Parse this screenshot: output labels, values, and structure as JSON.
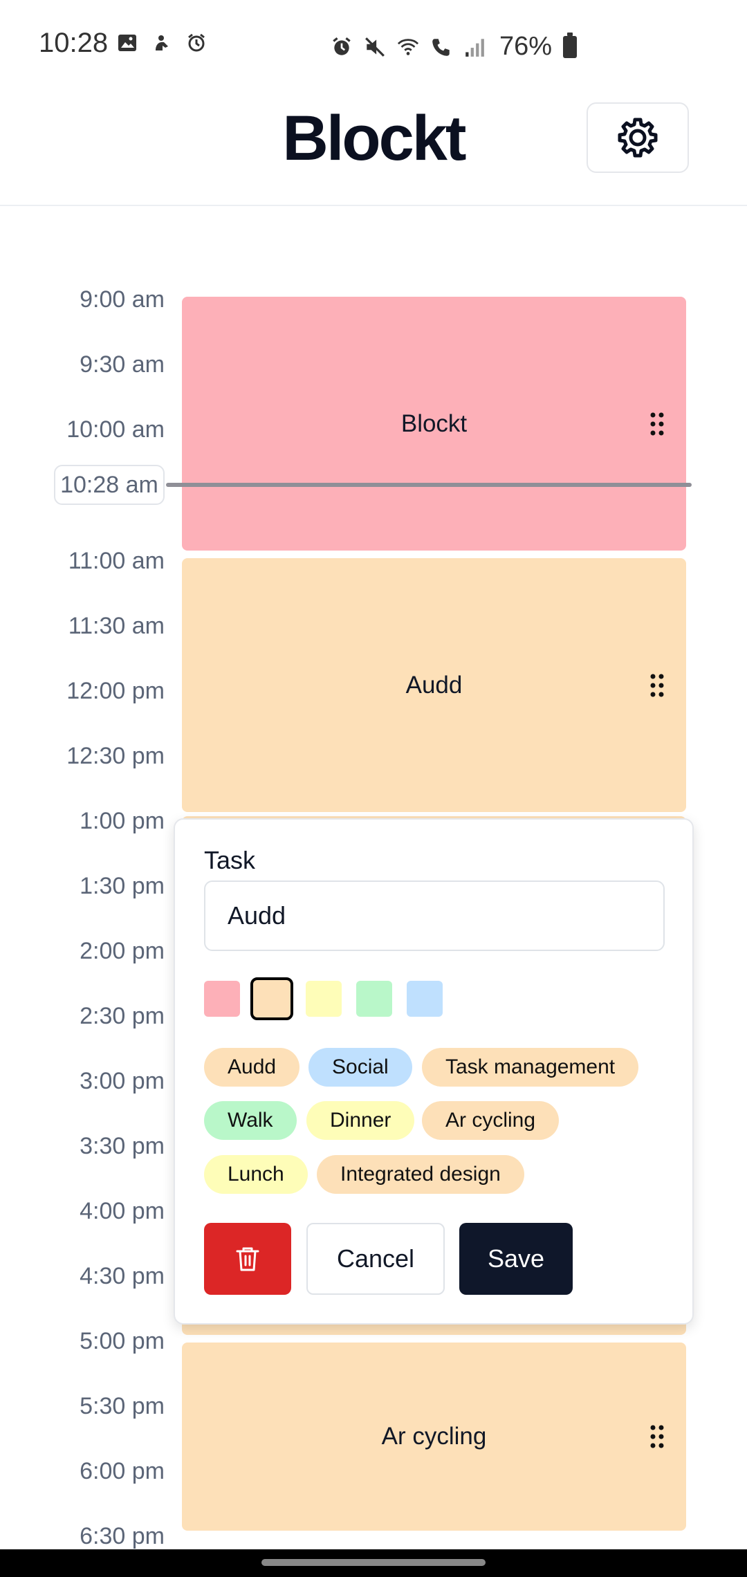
{
  "status_bar": {
    "time": "10:28",
    "battery_percent": "76%"
  },
  "header": {
    "title": "Blockt"
  },
  "timeline": {
    "labels": [
      "9:00 am",
      "9:30 am",
      "10:00 am",
      "11:00 am",
      "11:30 am",
      "12:00 pm",
      "12:30 pm",
      "1:00 pm",
      "1:30 pm",
      "2:00 pm",
      "2:30 pm",
      "3:00 pm",
      "3:30 pm",
      "4:00 pm",
      "4:30 pm",
      "5:00 pm",
      "5:30 pm",
      "6:00 pm",
      "6:30 pm"
    ],
    "now_label": "10:28 am"
  },
  "blocks": [
    {
      "title": "Blockt",
      "color": "#fdb0b8"
    },
    {
      "title": "Audd",
      "color": "#fde0b8"
    },
    {
      "title": "Ar cycling",
      "color": "#fde0b8"
    }
  ],
  "dialog": {
    "label": "Task",
    "value": "Audd",
    "colors": [
      "#fdb0b8",
      "#fde0b8",
      "#fefdb8",
      "#b9f7c9",
      "#bfe0fe"
    ],
    "selected_color_index": 1,
    "suggestions": [
      {
        "label": "Audd",
        "color": "#fde0b8"
      },
      {
        "label": "Social",
        "color": "#bfe0fe"
      },
      {
        "label": "Task management",
        "color": "#fde0b8"
      },
      {
        "label": "Walk",
        "color": "#b9f7c9"
      },
      {
        "label": "Dinner",
        "color": "#fefdb8"
      },
      {
        "label": "Ar cycling",
        "color": "#fde0b8"
      },
      {
        "label": "Lunch",
        "color": "#fefdb8"
      },
      {
        "label": "Integrated design",
        "color": "#fde0b8"
      }
    ],
    "cancel_label": "Cancel",
    "save_label": "Save"
  }
}
